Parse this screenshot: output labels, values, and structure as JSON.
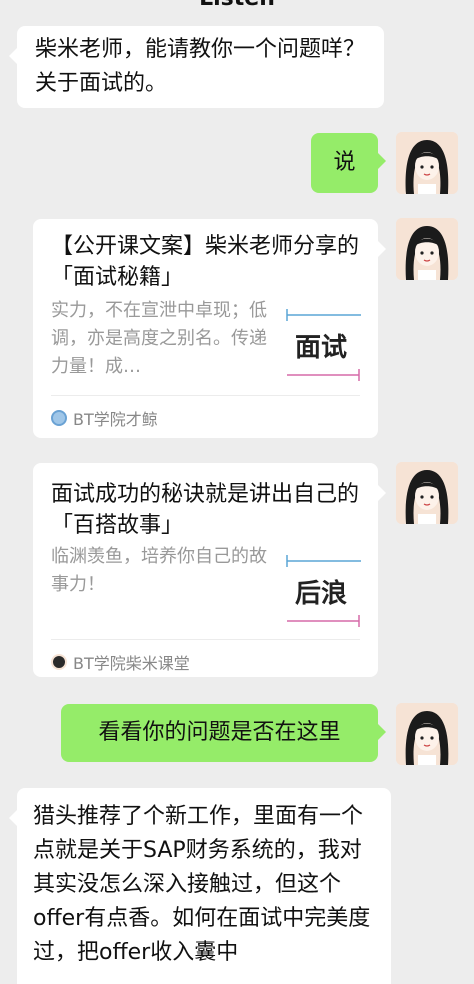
{
  "header": {
    "title": "Listen"
  },
  "messages": [
    {
      "text": "柴米老师，能请教你一个问题咩？关于面试的。"
    },
    {
      "text": "说"
    },
    {
      "title": "【公开课文案】柴米老师分享的「面试秘籍」",
      "desc": "实力，不在宣泄中卓现；低调，亦是高度之别名。传递力量！成…",
      "thumb_word": "面试",
      "source": "BT学院才鲸"
    },
    {
      "title": "面试成功的秘诀就是讲出自己的「百搭故事」",
      "desc": "临渊羡鱼，培养你自己的故事力！",
      "thumb_word": "后浪",
      "source": "BT学院柴米课堂"
    },
    {
      "text": "看看你的问题是否在这里"
    },
    {
      "text": "猎头推荐了个新工作，里面有一个点就是关于SAP财务系统的，我对其实没怎么深入接触过，但这个offer有点香。如何在面试中完美度过，把offer收入囊中"
    }
  ],
  "colors": {
    "green_bubble": "#95ec69",
    "background": "#ededed",
    "white_bubble": "#ffffff"
  }
}
